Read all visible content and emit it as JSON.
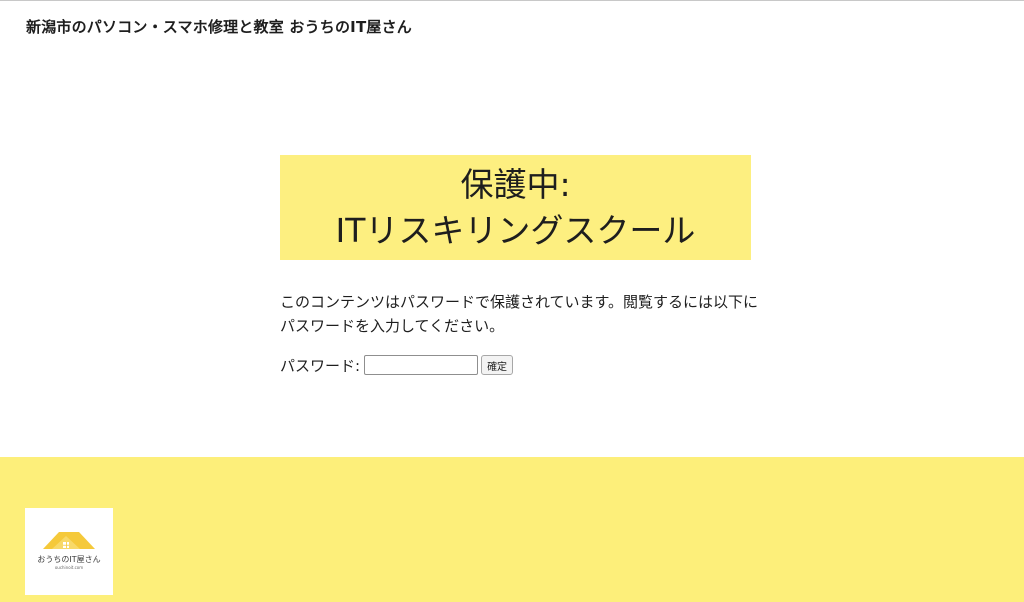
{
  "site": {
    "title": "新潟市のパソコン・スマホ修理と教室 おうちのIT屋さん"
  },
  "page": {
    "title_line1": "保護中:",
    "title_line2": "ITリスキリングスクール",
    "message": "このコンテンツはパスワードで保護されています。閲覧するには以下にパスワードを入力してください。"
  },
  "form": {
    "password_label": "パスワード:",
    "password_value": "",
    "submit_label": "確定"
  },
  "footer": {
    "logo_text": "おうちのIT屋さん",
    "logo_subtext": "ouchinoit.com",
    "logo_icon": "house-roof-icon"
  },
  "colors": {
    "accent_yellow": "#fdef80",
    "roof_yellow": "#f5c93a"
  }
}
